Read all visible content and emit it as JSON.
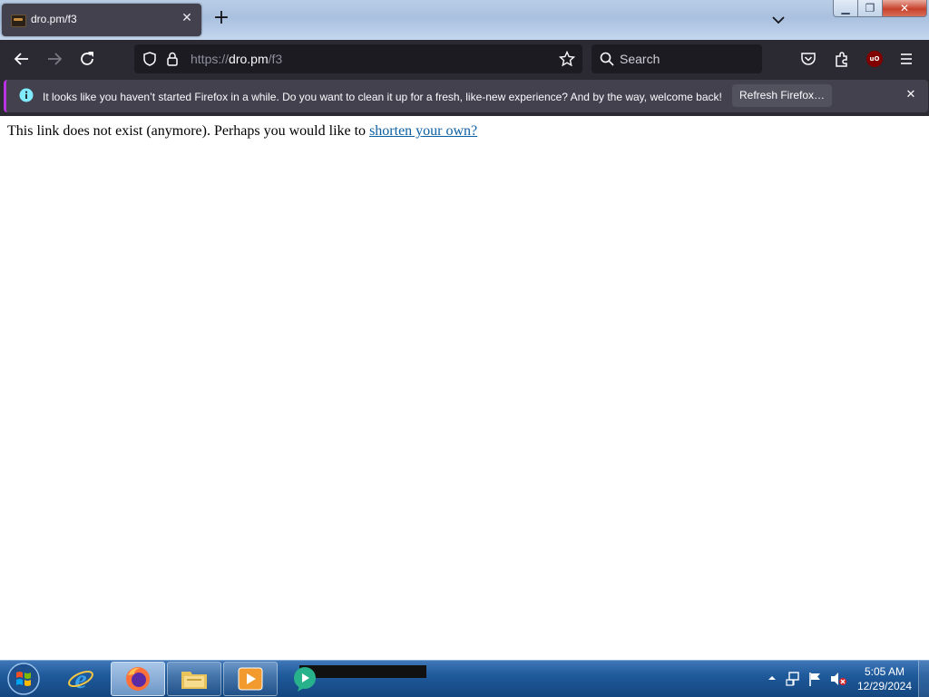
{
  "browser": {
    "tab": {
      "title": "dro.pm/f3"
    },
    "urlbar": {
      "scheme": "https://",
      "host": "dro.pm",
      "path": "/f3"
    },
    "search": {
      "placeholder": "Search"
    },
    "extension_badge": "uO",
    "notification": {
      "message": "It looks like you haven’t started Firefox in a while. Do you want to clean it up for a fresh, like-new experience? And by the way, welcome back!",
      "button_label": "Refresh Firefox…"
    }
  },
  "page": {
    "text": "This link does not exist (anymore). Perhaps you would like to",
    "link_text": "shorten your own?"
  },
  "taskbar": {
    "apps": [
      "internet-explorer",
      "firefox",
      "file-explorer",
      "media-player",
      "unknown-app"
    ],
    "clock": {
      "time": "5:05 AM",
      "date": "12/29/2024"
    }
  },
  "colors": {
    "toolbar": "#2b2a33",
    "tab_active": "#42414d",
    "notification_accent": "#b833e1",
    "link": "#0b5fa3"
  }
}
